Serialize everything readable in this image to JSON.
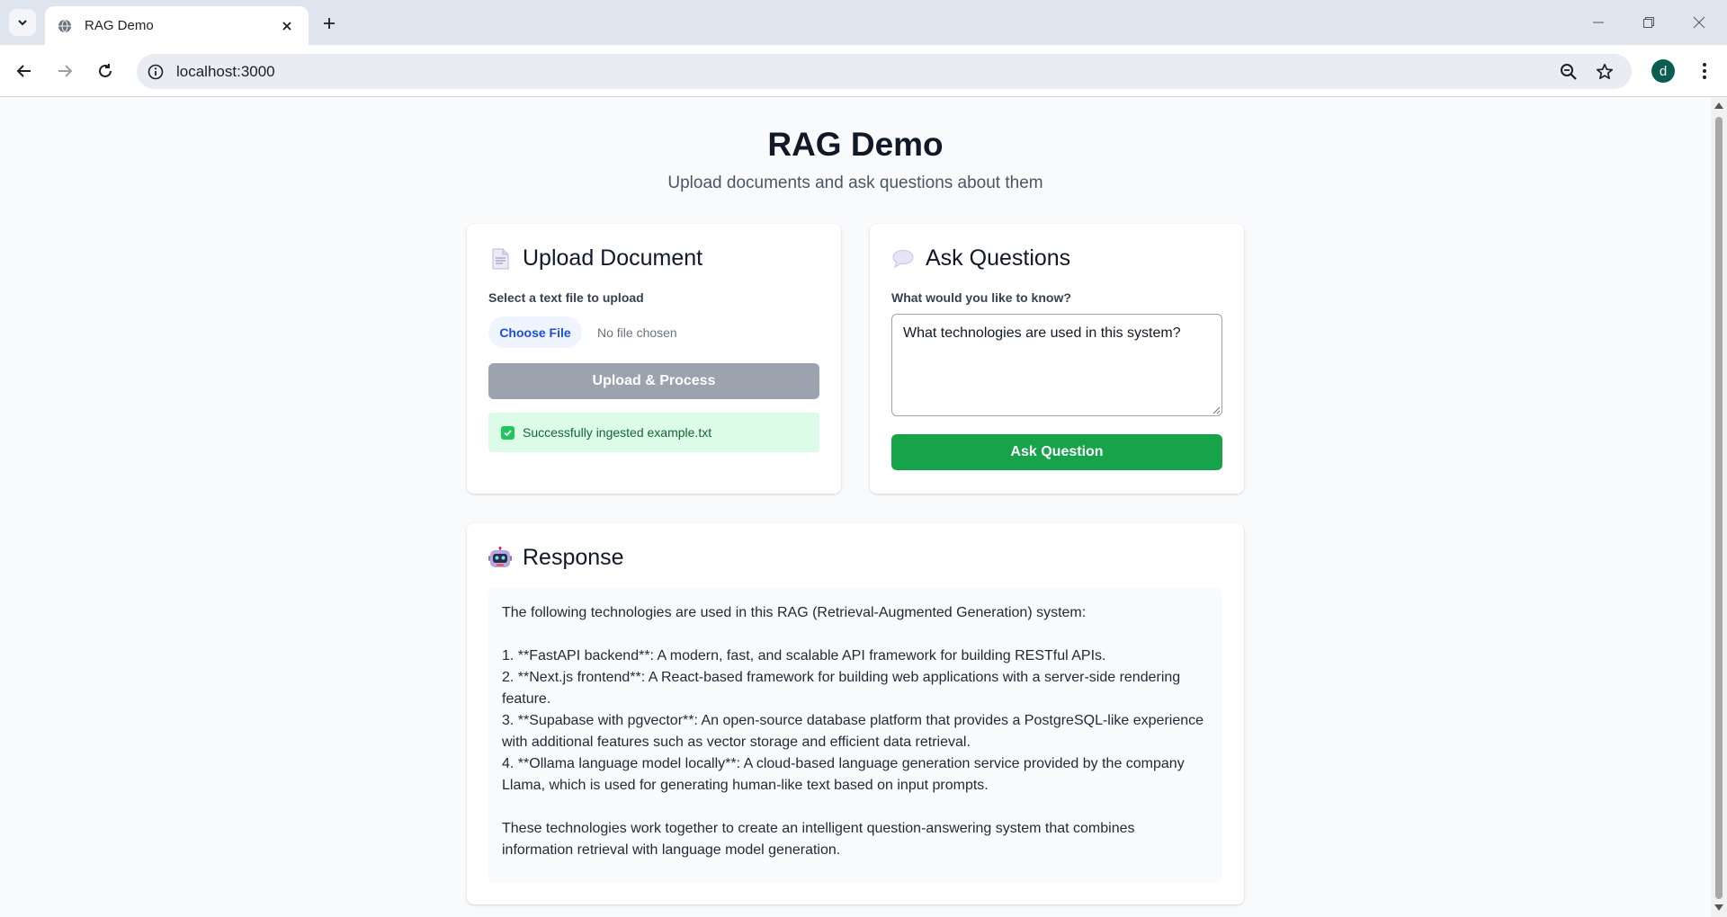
{
  "browser": {
    "tab_title": "RAG Demo",
    "url": "localhost:3000",
    "profile_initial": "d"
  },
  "page": {
    "title": "RAG Demo",
    "subtitle": "Upload documents and ask questions about them"
  },
  "upload_card": {
    "heading": "Upload Document",
    "icon": "document-icon",
    "field_label": "Select a text file to upload",
    "choose_file_label": "Choose File",
    "file_status": "No file chosen",
    "upload_button_label": "Upload & Process",
    "success_message": "Successfully ingested example.txt"
  },
  "ask_card": {
    "heading": "Ask Questions",
    "icon": "speech-bubble-icon",
    "field_label": "What would you like to know?",
    "question_value": "What technologies are used in this system?",
    "ask_button_label": "Ask Question"
  },
  "response_card": {
    "heading": "Response",
    "icon": "robot-icon",
    "text": "The following technologies are used in this RAG (Retrieval-Augmented Generation) system:\n\n1. **FastAPI backend**: A modern, fast, and scalable API framework for building RESTful APIs.\n2. **Next.js frontend**: A React-based framework for building web applications with a server-side rendering feature.\n3. **Supabase with pgvector**: An open-source database platform that provides a PostgreSQL-like experience with additional features such as vector storage and efficient data retrieval.\n4. **Ollama language model locally**: A cloud-based language generation service provided by the company Llama, which is used for generating human-like text based on input prompts.\n\nThese technologies work together to create an intelligent question-answering system that combines information retrieval with language model generation."
  },
  "colors": {
    "primary_green": "#16a34a",
    "disabled_gray": "#9ca3af",
    "success_bg": "#dcfce7",
    "success_text": "#166534",
    "link_blue": "#1d4ed8"
  }
}
